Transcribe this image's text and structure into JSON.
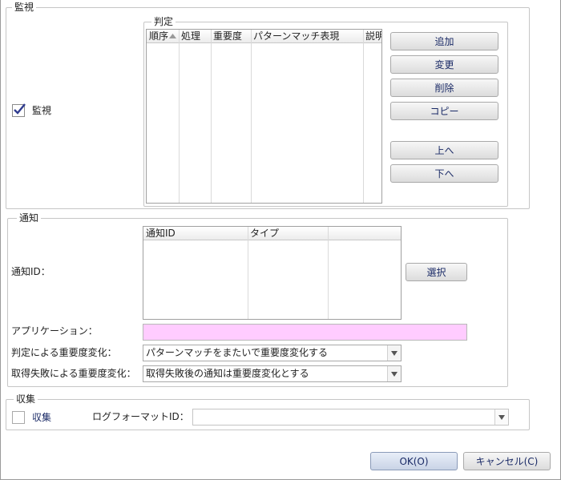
{
  "monitor_group": {
    "legend": "監視",
    "checkbox_label": "監視",
    "checkbox_checked": true,
    "judgement": {
      "legend": "判定",
      "columns": [
        "順序",
        "処理",
        "重要度",
        "パターンマッチ表現",
        "説明"
      ],
      "rows": []
    },
    "buttons": {
      "add": "追加",
      "edit": "変更",
      "delete": "削除",
      "copy": "コピー",
      "up": "上へ",
      "down": "下へ"
    }
  },
  "notify_group": {
    "legend": "通知",
    "notify_id_label": "通知ID：",
    "columns": [
      "通知ID",
      "タイプ",
      ""
    ],
    "rows": [],
    "select_button": "選択",
    "application_label": "アプリケーション：",
    "application_value": "",
    "application_highlight_color": "#ffccff",
    "severity_change_label": "判定による重要度変化：",
    "severity_change_value": "パターンマッチをまたいで重要度変化する",
    "failure_severity_label": "取得失敗による重要度変化：",
    "failure_severity_value": "取得失敗後の通知は重要度変化とする"
  },
  "collect_group": {
    "legend": "収集",
    "checkbox_label": "収集",
    "checkbox_checked": false,
    "log_format_label": "ログフォーマットID：",
    "log_format_value": ""
  },
  "dialog_buttons": {
    "ok": "OK(O)",
    "cancel": "キャンセル(C)"
  }
}
